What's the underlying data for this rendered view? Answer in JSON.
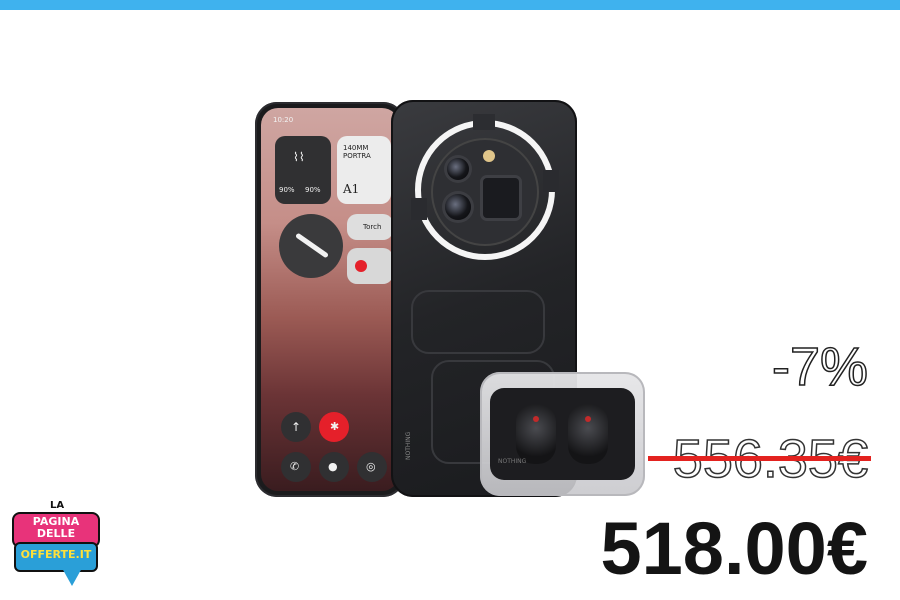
{
  "colors": {
    "top_bar": "#3fb2ee",
    "strike": "#e3221f",
    "logo_pink": "#e8337a",
    "logo_blue": "#2a9fd8"
  },
  "product": {
    "image": "phone-and-earbuds-bundle",
    "screen": {
      "time": "10:20",
      "camera_widget": "140MM PORTRA",
      "battery_left": "90%",
      "battery_right": "90%",
      "widget_label": "A1",
      "torch_label": "Torch"
    },
    "back_brand": "NOTHING",
    "case_brand": "NOTHING"
  },
  "pricing": {
    "discount": "-7%",
    "old_price": "556.35€",
    "new_price": "518.00€"
  },
  "logo": {
    "line1": "LA",
    "line2": "PAGINA DELLE",
    "line3": "OFFERTE.IT"
  }
}
